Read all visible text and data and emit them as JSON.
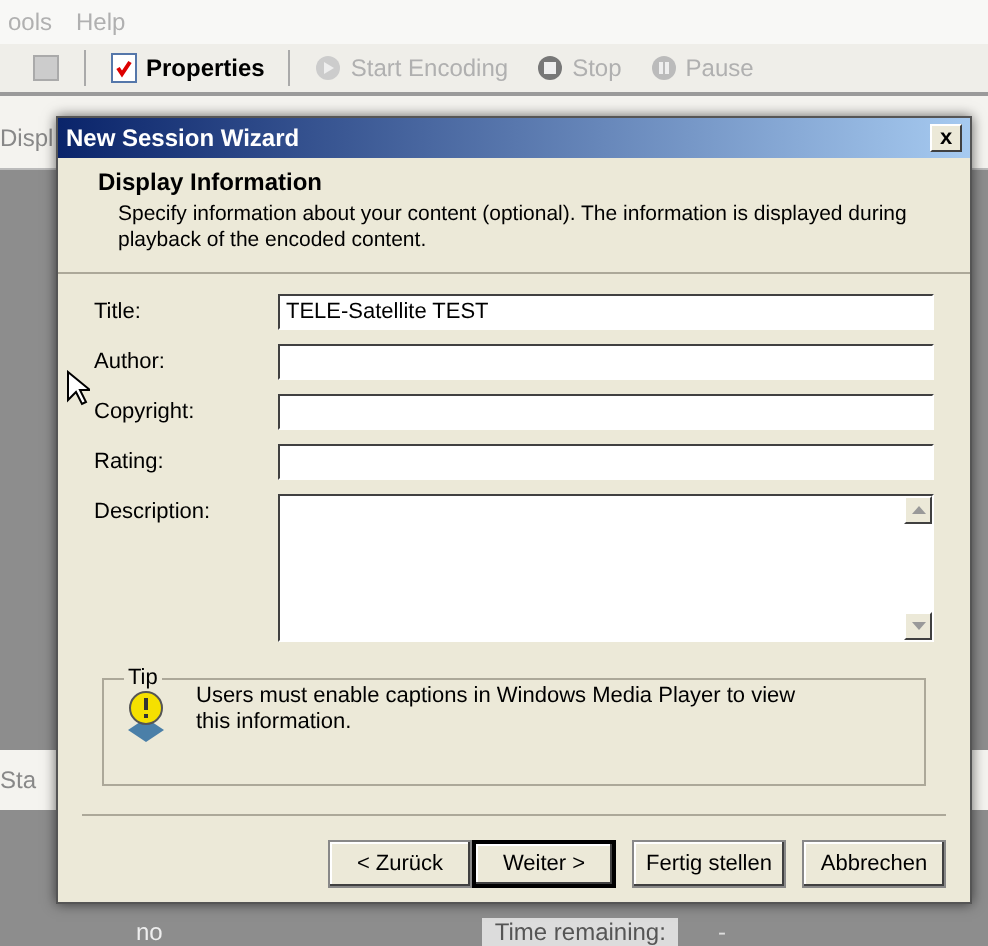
{
  "app": {
    "menu": [
      "ools",
      "Help"
    ],
    "toolbar": [
      {
        "kind": "save",
        "disabled": true
      },
      {
        "kind": "properties",
        "label": "Properties",
        "disabled": false
      },
      {
        "kind": "start",
        "label": "Start Encoding",
        "disabled": true
      },
      {
        "kind": "stop",
        "label": "Stop",
        "disabled": true
      },
      {
        "kind": "pause",
        "label": "Pause",
        "disabled": true
      }
    ],
    "side_tab": "Displ",
    "status_label": "Sta",
    "bottom_value": "no",
    "time_label": "Time remaining:",
    "time_value": "-"
  },
  "dialog": {
    "title": "New Session Wizard",
    "close": "x",
    "heading": "Display Information",
    "description": "Specify information about your content (optional). The information is displayed during playback of the encoded content.",
    "fields": [
      {
        "kind": "line",
        "label": "Title:",
        "value": "TELE-Satellite TEST"
      },
      {
        "kind": "line",
        "label": "Author:"
      },
      {
        "kind": "line",
        "label": "Copyright:"
      },
      {
        "kind": "line",
        "label": "Rating:"
      },
      {
        "kind": "multiline",
        "label": "Description:"
      }
    ],
    "tip": {
      "title": "Tip",
      "text": "Users must enable captions in Windows Media Player to view this information."
    },
    "buttons": [
      {
        "label": "< Zurück",
        "default": false
      },
      {
        "label": "Weiter >",
        "default": true
      },
      {
        "label": "Fertig stellen",
        "default": false
      },
      {
        "label": "Abbrechen",
        "default": false
      }
    ]
  }
}
